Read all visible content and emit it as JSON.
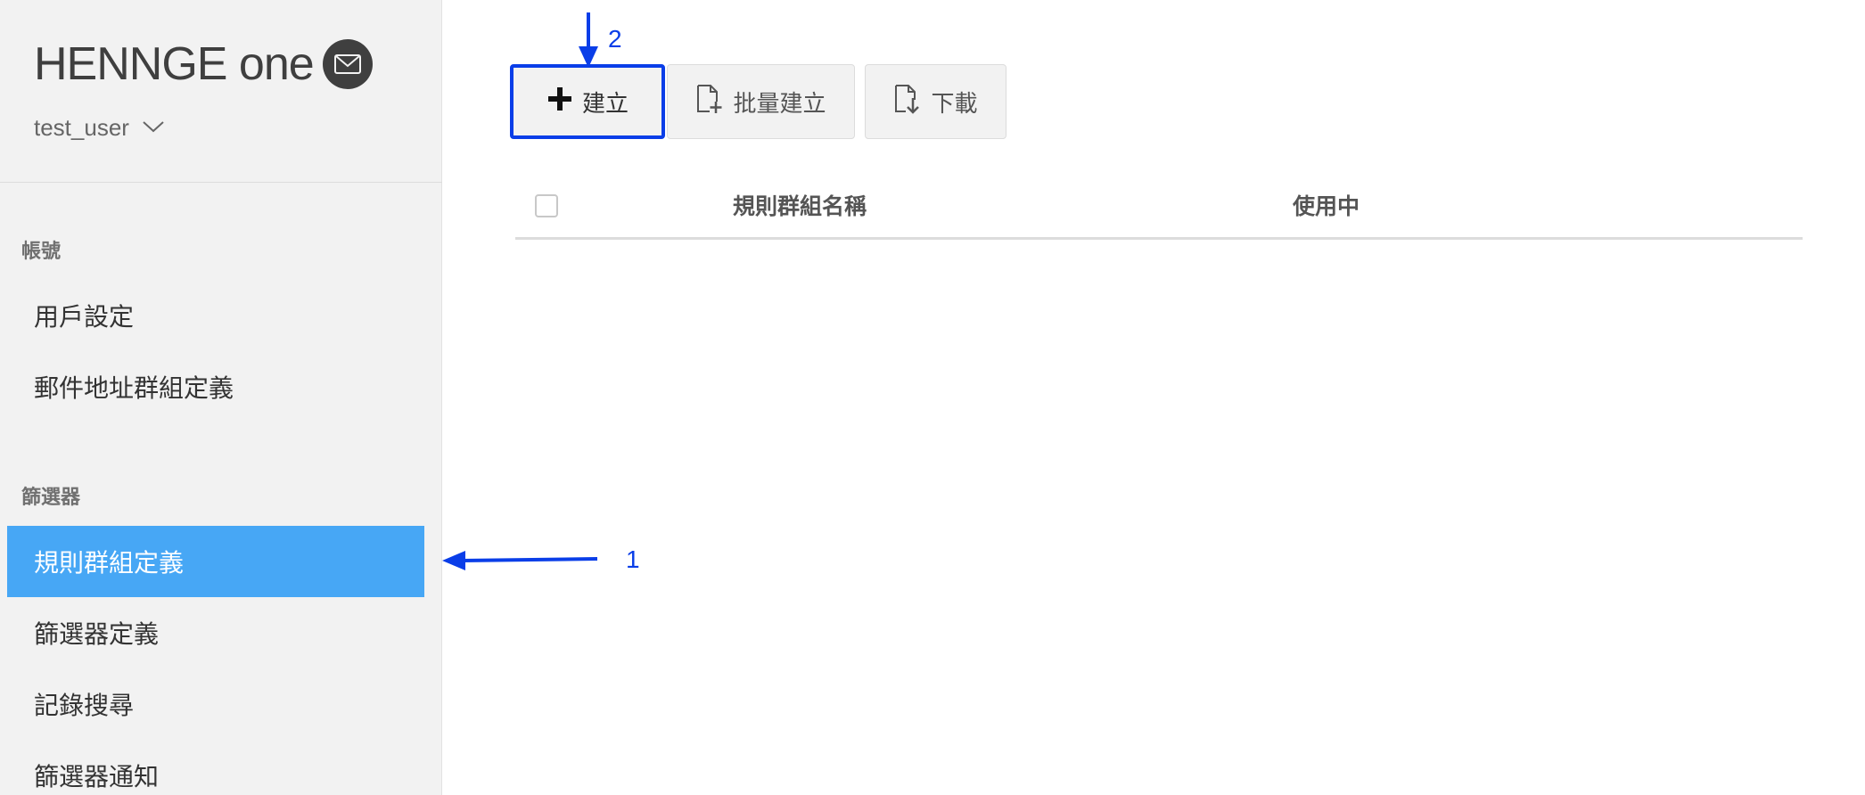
{
  "app": {
    "logo_text": "HENNGE one",
    "user_name": "test_user"
  },
  "sidebar": {
    "sections": [
      {
        "label": "帳號",
        "items": [
          {
            "label": "用戶設定"
          },
          {
            "label": "郵件地址群組定義"
          }
        ]
      },
      {
        "label": "篩選器",
        "items": [
          {
            "label": "規則群組定義",
            "active": true
          },
          {
            "label": "篩選器定義"
          },
          {
            "label": "記錄搜尋"
          },
          {
            "label": "篩選器通知"
          }
        ]
      }
    ]
  },
  "toolbar": {
    "create_label": "建立",
    "bulk_create_label": "批量建立",
    "download_label": "下載"
  },
  "table": {
    "columns": [
      "規則群組名稱",
      "使用中"
    ]
  },
  "annotations": {
    "marker_1": "1",
    "marker_2": "2",
    "color": "#0a3ee8"
  },
  "colors": {
    "sidebar_bg": "#f2f2f2",
    "active_item": "#47a7f5",
    "annotation": "#0a3ee8"
  },
  "icons": [
    "mail-icon",
    "chevron-down-icon",
    "plus-icon",
    "file-add-icon",
    "file-download-icon"
  ]
}
